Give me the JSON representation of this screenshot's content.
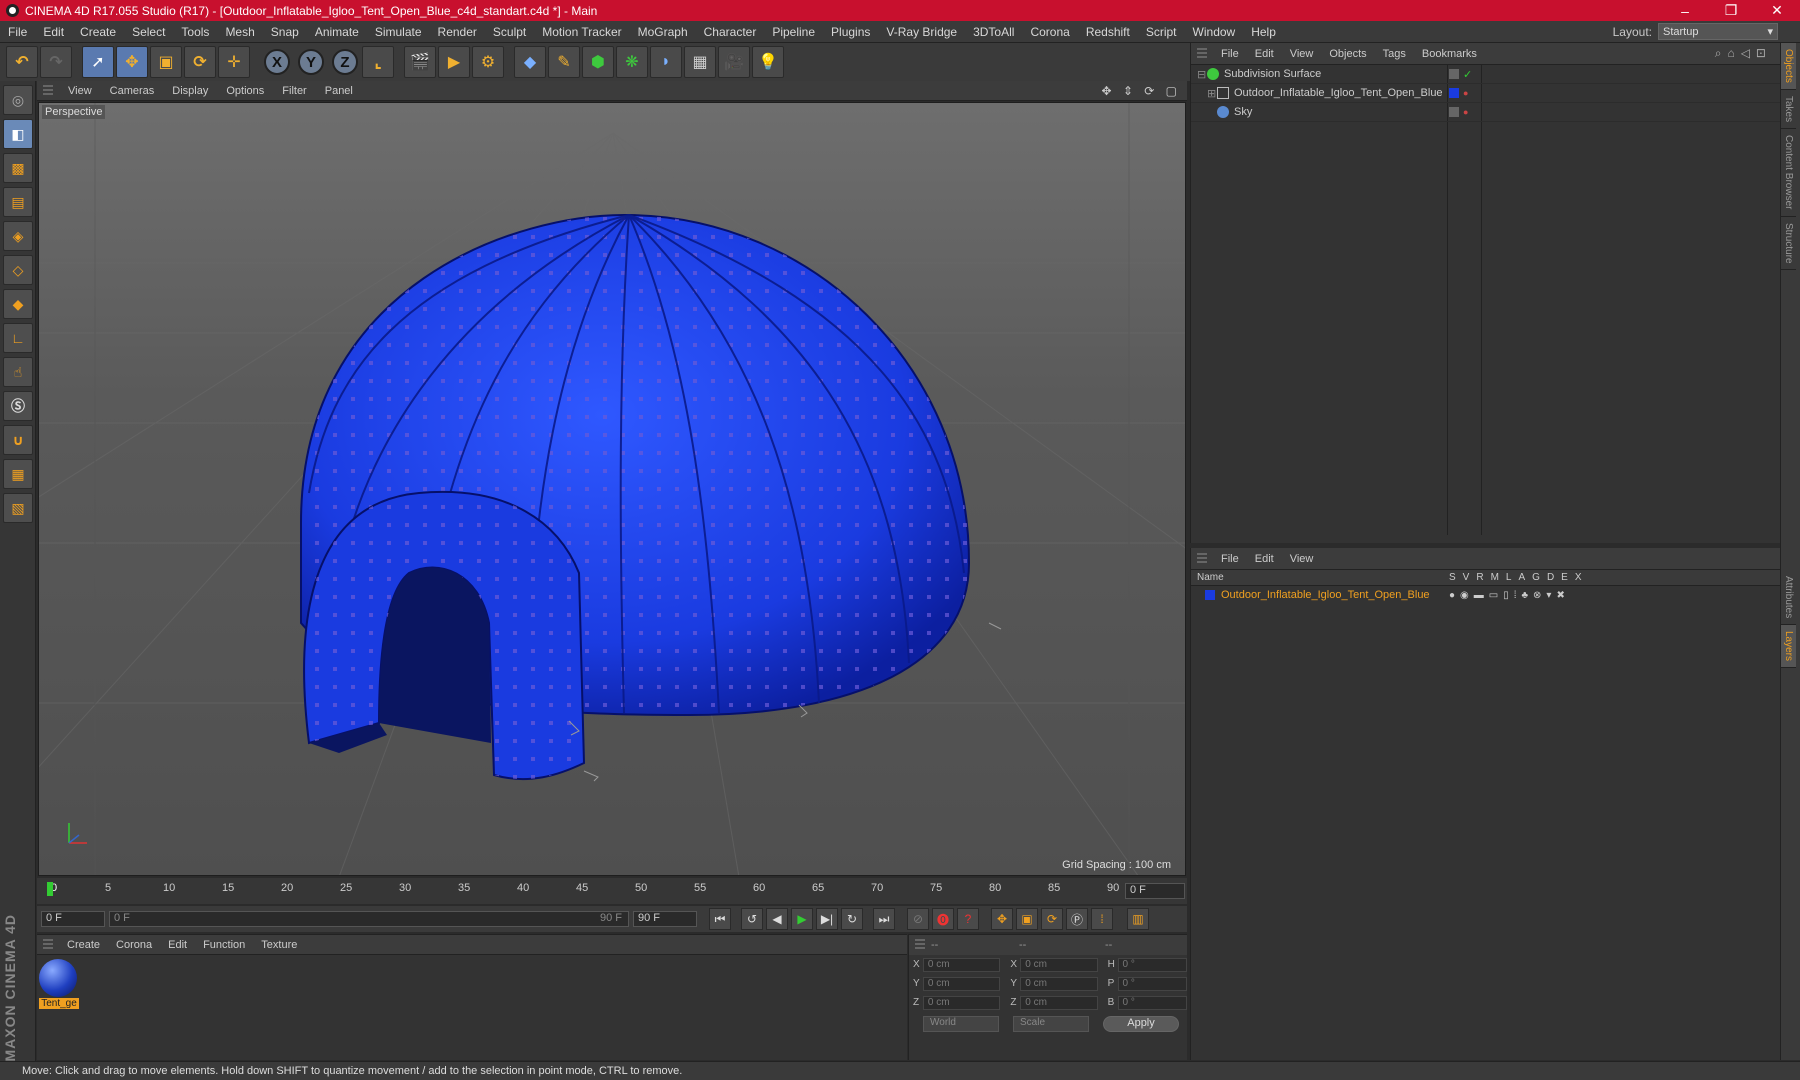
{
  "window": {
    "title": "CINEMA 4D R17.055 Studio (R17) - [Outdoor_Inflatable_Igloo_Tent_Open_Blue_c4d_standart.c4d *] - Main",
    "minimize": "–",
    "maximize": "❐",
    "close": "✕"
  },
  "menu": [
    "File",
    "Edit",
    "Create",
    "Select",
    "Tools",
    "Mesh",
    "Snap",
    "Animate",
    "Simulate",
    "Render",
    "Sculpt",
    "Motion Tracker",
    "MoGraph",
    "Character",
    "Pipeline",
    "Plugins",
    "V-Ray Bridge",
    "3DToAll",
    "Corona",
    "Redshift",
    "Script",
    "Window",
    "Help"
  ],
  "layout": {
    "label": "Layout:",
    "value": "Startup"
  },
  "toolbar": {
    "axes": [
      "X",
      "Y",
      "Z"
    ]
  },
  "viewport": {
    "menu": [
      "View",
      "Cameras",
      "Display",
      "Options",
      "Filter",
      "Panel"
    ],
    "label": "Perspective",
    "grid_spacing": "Grid Spacing : 100 cm",
    "nav_icons": "✥ ⇕ ⟳ ▢",
    "tent_color": "#1a3be0"
  },
  "timeline": {
    "ticks": [
      "0",
      "5",
      "10",
      "15",
      "20",
      "25",
      "30",
      "35",
      "40",
      "45",
      "50",
      "55",
      "60",
      "65",
      "70",
      "75",
      "80",
      "85",
      "90"
    ],
    "current_frame": "0 F"
  },
  "playbar": {
    "start": "0 F",
    "range_start": "0 F",
    "range_end": "90 F",
    "end": "90 F"
  },
  "materials": {
    "menu": [
      "Create",
      "Corona",
      "Edit",
      "Function",
      "Texture"
    ],
    "items": [
      {
        "name": "Tent_ge"
      }
    ]
  },
  "coordinates": {
    "headers": [
      "--",
      "--",
      "--"
    ],
    "rows": [
      {
        "a": "X",
        "av": "0 cm",
        "b": "X",
        "bv": "0 cm",
        "c": "H",
        "cv": "0 °"
      },
      {
        "a": "Y",
        "av": "0 cm",
        "b": "Y",
        "bv": "0 cm",
        "c": "P",
        "cv": "0 °"
      },
      {
        "a": "Z",
        "av": "0 cm",
        "b": "Z",
        "bv": "0 cm",
        "c": "B",
        "cv": "0 °"
      }
    ],
    "mode": "World",
    "size_mode": "Scale",
    "apply": "Apply"
  },
  "objects": {
    "menu": [
      "File",
      "Edit",
      "View",
      "Objects",
      "Tags",
      "Bookmarks"
    ],
    "items": [
      {
        "name": "Subdivision Surface",
        "color": "#3ec93e"
      },
      {
        "name": "Outdoor_Inflatable_Igloo_Tent_Open_Blue",
        "color": "#888888"
      },
      {
        "name": "Sky",
        "color": "#5a8ad0"
      }
    ]
  },
  "layers": {
    "menu": [
      "File",
      "Edit",
      "View"
    ],
    "name_header": "Name",
    "columns": [
      "S",
      "V",
      "R",
      "M",
      "L",
      "A",
      "G",
      "D",
      "E",
      "X"
    ],
    "items": [
      {
        "name": "Outdoor_Inflatable_Igloo_Tent_Open_Blue",
        "color": "#1a3be0"
      }
    ]
  },
  "side_tabs": [
    "Objects",
    "Takes",
    "Content Browser",
    "Structure",
    "Attributes",
    "Layers"
  ],
  "status": "Move: Click and drag to move elements. Hold down SHIFT to quantize movement / add to the selection in point mode, CTRL to remove.",
  "brand": "MAXON CINEMA 4D"
}
